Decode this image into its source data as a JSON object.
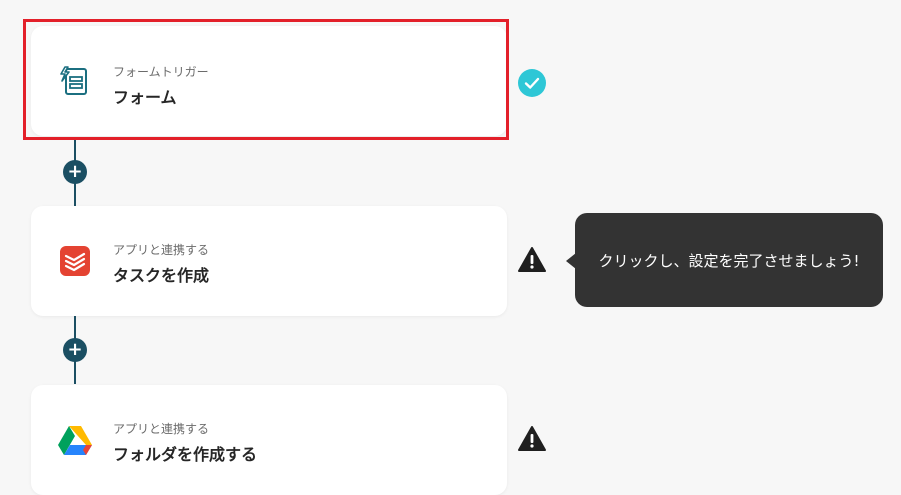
{
  "steps": [
    {
      "subtitle": "フォームトリガー",
      "title": "フォーム",
      "icon": "form-trigger-icon",
      "status": "check-icon"
    },
    {
      "subtitle": "アプリと連携する",
      "title": "タスクを作成",
      "icon": "todoist-icon",
      "status": "warning-icon"
    },
    {
      "subtitle": "アプリと連携する",
      "title": "フォルダを作成する",
      "icon": "google-drive-icon",
      "status": "warning-icon"
    }
  ],
  "tooltip": {
    "text": "クリックし、設定を完了させましょう!"
  },
  "add_button": {
    "label": "+"
  },
  "colors": {
    "highlight": "#e3202a",
    "connector": "#1b4f63",
    "check": "#2ec7d6",
    "tooltip_bg": "#333333",
    "todoist": "#e44332"
  }
}
